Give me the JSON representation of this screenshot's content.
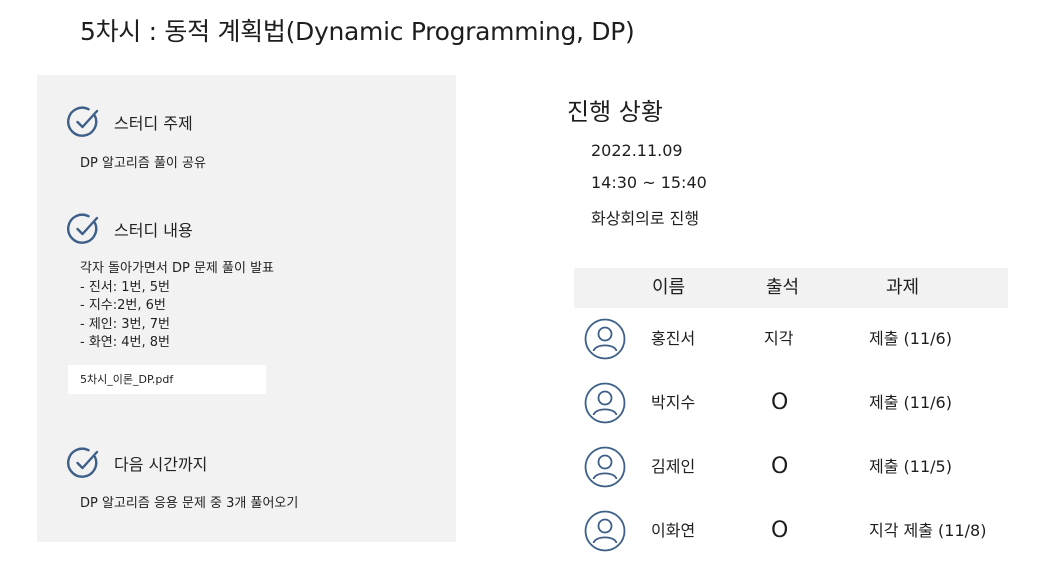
{
  "page_title": "5차시 : 동적 계획법(Dynamic Programming, DP)",
  "colors": {
    "accent": "#3d5f88",
    "panel_bg": "#f2f2f2"
  },
  "sections": [
    {
      "icon": "check-circle-icon",
      "title": "스터디 주제",
      "lines": [
        "DP 알고리즘 풀이 공유"
      ]
    },
    {
      "icon": "check-circle-icon",
      "title": "스터디 내용",
      "lines": [
        "각자 돌아가면서 DP 문제 풀이 발표",
        "- 진서: 1번, 5번",
        "- 지수:2번, 6번",
        "- 제인: 3번, 7번",
        "- 화연: 4번, 8번"
      ]
    },
    {
      "icon": "check-circle-icon",
      "title": "다음 시간까지",
      "lines": [
        "DP 알고리즘 응용 문제 중 3개 풀어오기"
      ]
    }
  ],
  "attachment": "5차시_이론_DP.pdf",
  "progress": {
    "title": "진행 상황",
    "date": "2022.11.09",
    "time": "14:30 ~ 15:40",
    "mode": "화상회의로 진행"
  },
  "attendance": {
    "headers": [
      "이름",
      "출석",
      "과제"
    ],
    "rows": [
      {
        "avatar": "user-icon",
        "name": "홍진서",
        "attendance": "지각",
        "assignment": "제출 (11/6)"
      },
      {
        "avatar": "user-icon",
        "name": "박지수",
        "attendance": "O",
        "assignment": "제출 (11/6)"
      },
      {
        "avatar": "user-icon",
        "name": "김제인",
        "attendance": "O",
        "assignment": "제출 (11/5)"
      },
      {
        "avatar": "user-icon",
        "name": "이화연",
        "attendance": "O",
        "assignment": "지각 제출 (11/8)"
      }
    ]
  }
}
